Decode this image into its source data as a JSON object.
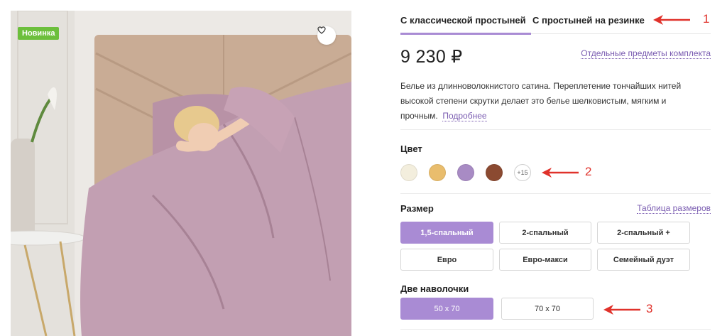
{
  "product": {
    "badge": "Новинка",
    "favorite_icon": "heart-outline-icon"
  },
  "tabs": [
    {
      "label": "С классической простыней",
      "active": true
    },
    {
      "label": "С простыней на резинке",
      "active": false
    }
  ],
  "price": "9 230 ₽",
  "items_link": "Отдельные предметы комплекта",
  "description": {
    "line1": "Белье из длинноволокнистого сатина. Переплетение тончайших нитей",
    "line2": "высокой степени скрутки делает это белье шелковистым, мягким и",
    "line3": "прочным.",
    "more": "Подробнее"
  },
  "color": {
    "label": "Цвет",
    "swatches": [
      "#f3eedd",
      "#e9bd6d",
      "#a88bc4",
      "#8b4a31"
    ],
    "more": "+15"
  },
  "size": {
    "label": "Размер",
    "table_link": "Таблица размеров",
    "options": [
      "1,5-спальный",
      "2-спальный",
      "2-спальный +",
      "Евро",
      "Евро-макси",
      "Семейный дуэт"
    ],
    "selected": "1,5-спальный"
  },
  "pillowcases": {
    "label": "Две наволочки",
    "options": [
      "50 x 70",
      "70 x 70"
    ],
    "selected": "50 x 70"
  },
  "annotations": {
    "accent": "#e0322b",
    "marks": [
      "1",
      "2",
      "3"
    ]
  },
  "colors": {
    "accent": "#a98bd4",
    "link": "#7a5cb1",
    "badge": "#6cbf3c"
  }
}
